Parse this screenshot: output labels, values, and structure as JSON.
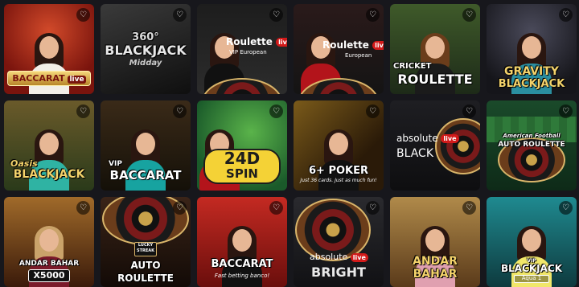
{
  "favorite_icon": "heart-outline-icon",
  "favorite_glyph": "♡",
  "tiles": [
    {
      "id": "baccarat-live",
      "line1": "BACCARAT",
      "line2": "live"
    },
    {
      "id": "blackjack-midday",
      "line1": "360°",
      "line2": "BLACKJACK",
      "line3": "Midday"
    },
    {
      "id": "roulette-vip",
      "line1": "Roulette",
      "badge": "live",
      "line2": "VIP",
      "line3": "European"
    },
    {
      "id": "roulette-european",
      "line1": "Roulette",
      "badge": "live",
      "line2": "European"
    },
    {
      "id": "cricket-roulette",
      "line1": "CRICKET",
      "line2": "ROULETTE"
    },
    {
      "id": "gravity-blackjack",
      "line1": "GRAVITY",
      "line2": "BLACKJACK"
    },
    {
      "id": "oasis-blackjack",
      "line1": "Oasis",
      "line2": "BLACKJACK"
    },
    {
      "id": "vip-baccarat",
      "line1": "VIP",
      "line2": "BACCARAT"
    },
    {
      "id": "24d-spin",
      "line1": "24D",
      "line2": "SPIN"
    },
    {
      "id": "6-plus-poker",
      "line1": "6+ POKER",
      "line2": "Just 36 cards. Just as much fun!"
    },
    {
      "id": "absolute-blackjack",
      "line1": "absolute",
      "badge": "live",
      "line2": "BLACK"
    },
    {
      "id": "auto-roulette-football",
      "line1": "American Football",
      "line2": "AUTO ROULETTE"
    },
    {
      "id": "andar-bahar-x5000",
      "line1": "ANDAR BAHAR",
      "line2": "X5000"
    },
    {
      "id": "auto-roulette-lucky-streak",
      "line1": "LUCKY",
      "line2": "STREAK",
      "line3": "AUTO",
      "line4": "ROULETTE"
    },
    {
      "id": "baccarat-fast",
      "line1": "BACCARAT",
      "line2": "Fast betting banco!"
    },
    {
      "id": "absolute-bright",
      "line1": "absolute",
      "badge": "live",
      "line2": "BRIGHT"
    },
    {
      "id": "andar-bahar",
      "line1": "ANDAR",
      "line2": "BAHAR"
    },
    {
      "id": "vip-blackjack-aqua",
      "line1": "VIP",
      "line2": "BLACKJACK",
      "line3": "Aqua 1"
    }
  ]
}
